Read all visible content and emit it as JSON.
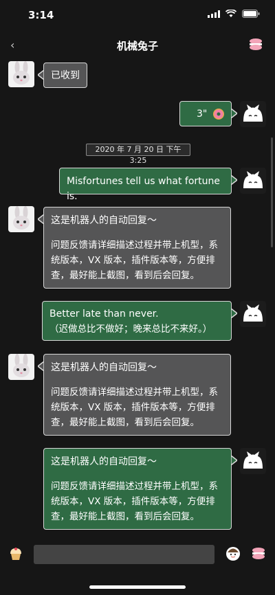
{
  "status": {
    "time": "3:14"
  },
  "nav": {
    "back_icon": "‹",
    "title": "机械兔子"
  },
  "timestamp": "2020 年 7 月 20 日 下午 3:25",
  "messages": [
    {
      "side": "left",
      "color": "gray",
      "text": "已收到"
    },
    {
      "side": "right",
      "color": "green",
      "text": "3\""
    },
    {
      "side": "right",
      "color": "green",
      "text": "Misfortunes tell us what fortune is."
    },
    {
      "side": "left",
      "color": "gray",
      "line1": "这是机器人的自动回复～",
      "line2": "问题反馈请详细描述过程并带上机型，系统版本，VX 版本，插件版本等，方便排查，最好能上截图，看到后会回复。"
    },
    {
      "side": "right",
      "color": "green",
      "line1": "Better late than never.",
      "line2": "（迟做总比不做好；晚来总比不来好。）"
    },
    {
      "side": "left",
      "color": "gray",
      "line1": "这是机器人的自动回复～",
      "line2": "问题反馈请详细描述过程并带上机型，系统版本，VX 版本，插件版本等，方便排查，最好能上截图，看到后会回复。"
    },
    {
      "side": "right",
      "color": "green",
      "line1": "这是机器人的自动回复～",
      "line2": "问题反馈请详细描述过程并带上机型，系统版本，VX 版本，插件版本等，方便排查，最好能上截图，看到后会回复。"
    }
  ],
  "icons": {
    "rabbit_avatar": "rabbit-avatar-icon",
    "cat_avatar": "cat-avatar-icon",
    "donut": "donut-icon",
    "macaron": "macaron-icon",
    "cupcake": "cupcake-icon",
    "sticker": "sticker-icon"
  },
  "colors": {
    "background": "#161616",
    "green_bubble": "#2f6b44",
    "gray_bubble": "#555556"
  }
}
